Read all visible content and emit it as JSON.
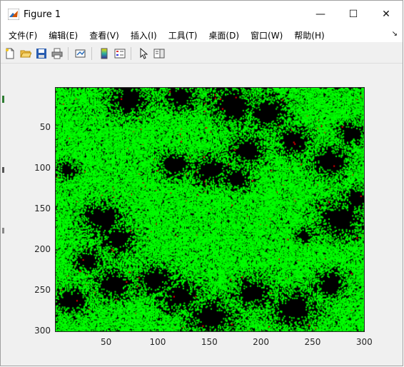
{
  "window": {
    "title": "Figure 1"
  },
  "window_controls": {
    "minimize": "—",
    "maximize": "☐",
    "close": "✕"
  },
  "menubar": {
    "items": [
      "文件(F)",
      "编辑(E)",
      "查看(V)",
      "插入(I)",
      "工具(T)",
      "桌面(D)",
      "窗口(W)",
      "帮助(H)"
    ],
    "overflow": "↘"
  },
  "toolbar": {
    "icons": [
      "new-figure-icon",
      "open-file-icon",
      "save-icon",
      "print-icon",
      "link-icon",
      "colorbar-icon",
      "legend-icon",
      "pointer-icon",
      "property-editor-icon"
    ]
  },
  "chart_data": {
    "type": "heatmap",
    "description": "binary image of green and black pixels with sparse red pixels",
    "x_ticks": [
      "50",
      "100",
      "150",
      "200",
      "250",
      "300"
    ],
    "y_ticks": [
      "50",
      "100",
      "150",
      "200",
      "250",
      "300"
    ],
    "xlim": [
      0.5,
      300.5
    ],
    "ylim": [
      0.5,
      300.5
    ],
    "colors": {
      "foreground": "#00ff00",
      "background": "#000000",
      "accent": "#ff0000"
    }
  }
}
